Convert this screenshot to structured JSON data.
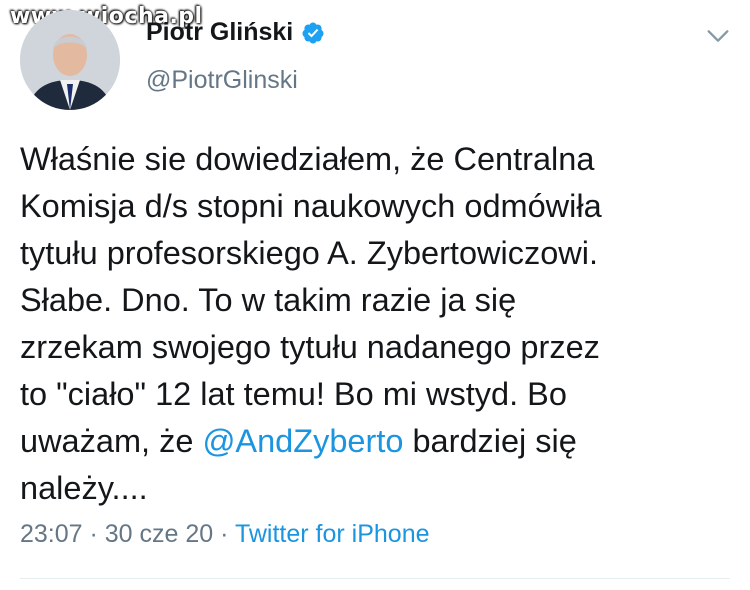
{
  "watermark": "www.wiocha.pl",
  "profile": {
    "name": "Piotr Gliński",
    "handle": "@PiotrGlinski"
  },
  "tweet": {
    "lines": [
      "Właśnie sie dowiedziałem, że Centralna",
      "Komisja d/s stopni naukowych odmówiła",
      "tytułu profesorskiego A. Zybertowiczowi.",
      "Słabe. Dno. To w takim razie ja się",
      "zrzekam swojego tytułu nadanego przez",
      "to \"ciało\" 12 lat temu! Bo mi wstyd. Bo"
    ],
    "line7_before": "uważam, że ",
    "mention": "@AndZyberto",
    "line7_after": " bardziej się",
    "line8": "należy...."
  },
  "meta": {
    "time": "23:07",
    "date": "30 cze 20",
    "separator": " · ",
    "source": "Twitter for iPhone"
  },
  "colors": {
    "accent": "#1b95e0",
    "secondary_text": "#657786",
    "primary_text": "#14171a"
  },
  "icons": [
    "verified-badge-icon",
    "chevron-down-icon",
    "avatar-photo"
  ]
}
